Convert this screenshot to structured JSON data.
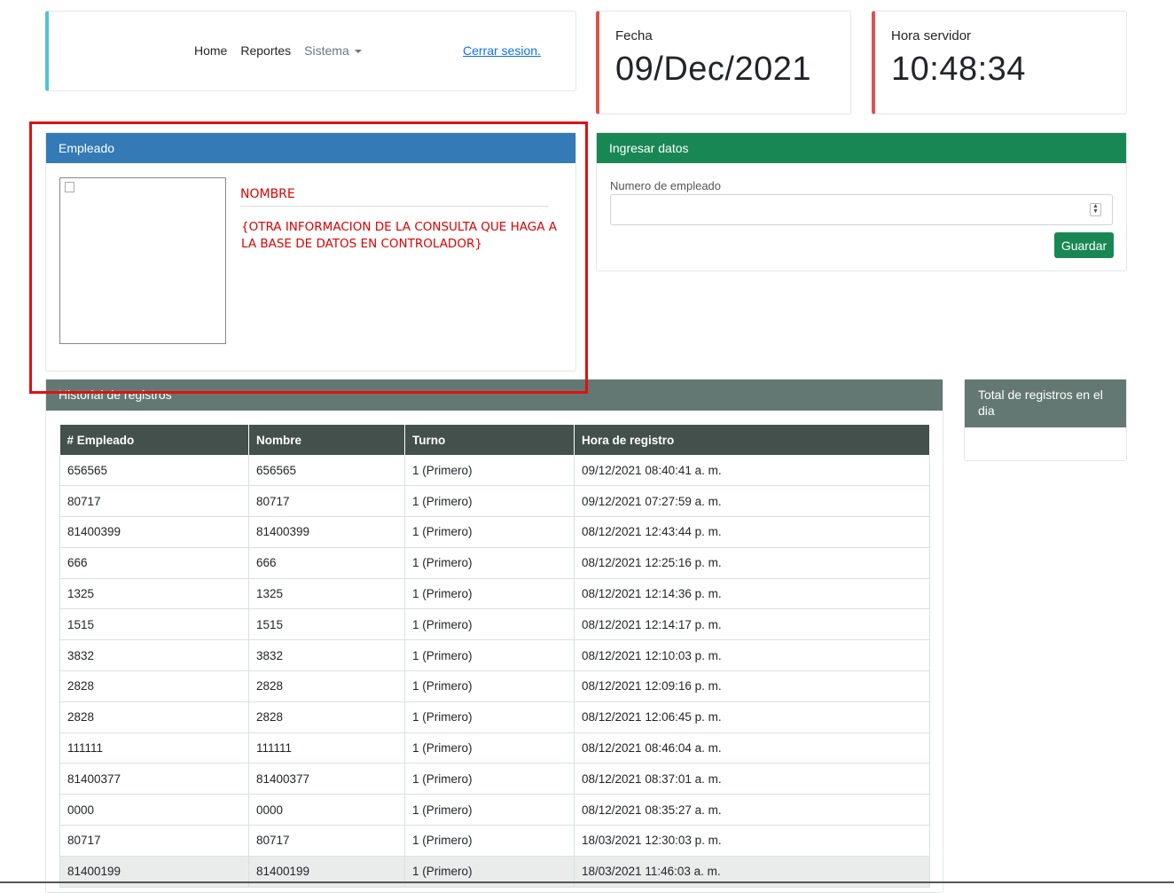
{
  "nav": {
    "links": [
      "Home",
      "Reportes",
      "Sistema"
    ],
    "logout": "Cerrar sesion."
  },
  "date": {
    "label": "Fecha",
    "value": "09/Dec/2021"
  },
  "time": {
    "label": "Hora servidor",
    "value": "10:48:34"
  },
  "employee": {
    "header": "Empleado",
    "name": "NOMBRE",
    "info": "{OTRA INFORMACION DE LA CONSULTA QUE HAGA A LA BASE DE DATOS EN CONTROLADOR}"
  },
  "input_panel": {
    "header": "Ingresar datos",
    "field_label": "Numero de empleado",
    "field_value": "",
    "button": "Guardar"
  },
  "history": {
    "header": "Historial de registros",
    "columns": [
      "# Empleado",
      "Nombre",
      "Turno",
      "Hora de registro"
    ],
    "rows": [
      [
        "656565",
        "656565",
        "1 (Primero)",
        "09/12/2021 08:40:41 a. m."
      ],
      [
        "80717",
        "80717",
        "1 (Primero)",
        "09/12/2021 07:27:59 a. m."
      ],
      [
        "81400399",
        "81400399",
        "1 (Primero)",
        "08/12/2021 12:43:44 p. m."
      ],
      [
        "666",
        "666",
        "1 (Primero)",
        "08/12/2021 12:25:16 p. m."
      ],
      [
        "1325",
        "1325",
        "1 (Primero)",
        "08/12/2021 12:14:36 p. m."
      ],
      [
        "1515",
        "1515",
        "1 (Primero)",
        "08/12/2021 12:14:17 p. m."
      ],
      [
        "3832",
        "3832",
        "1 (Primero)",
        "08/12/2021 12:10:03 p. m."
      ],
      [
        "2828",
        "2828",
        "1 (Primero)",
        "08/12/2021 12:09:16 p. m."
      ],
      [
        "2828",
        "2828",
        "1 (Primero)",
        "08/12/2021 12:06:45 p. m."
      ],
      [
        "111111",
        "111111",
        "1 (Primero)",
        "08/12/2021 08:46:04 a. m."
      ],
      [
        "81400377",
        "81400377",
        "1 (Primero)",
        "08/12/2021 08:37:01 a. m."
      ],
      [
        "0000",
        "0000",
        "1 (Primero)",
        "08/12/2021 08:35:27 a. m."
      ],
      [
        "80717",
        "80717",
        "1 (Primero)",
        "18/03/2021 12:30:03 p. m."
      ],
      [
        "81400199",
        "81400199",
        "1 (Primero)",
        "18/03/2021 11:46:03 a. m."
      ]
    ]
  },
  "total": {
    "header": "Total de registros en el dia"
  }
}
